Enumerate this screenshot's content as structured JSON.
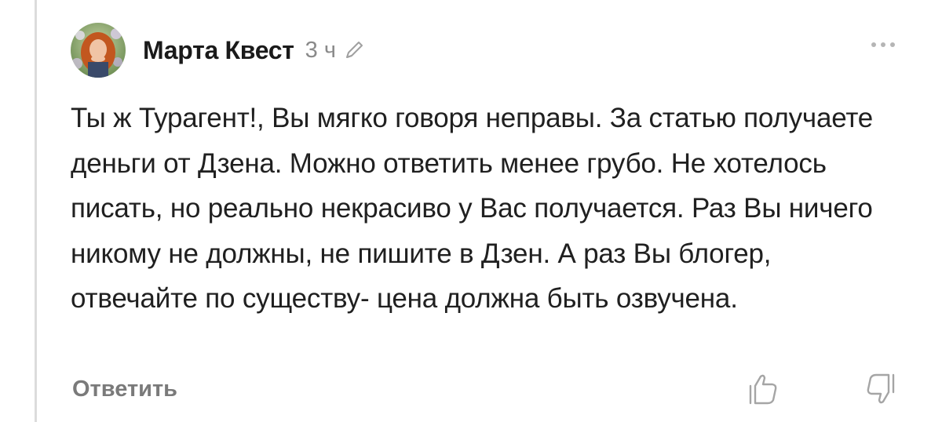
{
  "comment": {
    "author": "Марта Квест",
    "time": "3 ч",
    "text": "Ты ж Турагент!, Вы мягко говоря неправы. За статью получаете деньги от Дзена. Можно ответить менее грубо. Не хотелось писать, но реально некрасиво у Вас получается. Раз Вы ничего никому не должны, не пишите в Дзен. А раз Вы блогер, отвечайте по существу- цена должна быть озвучена.",
    "reply_label": "Ответить"
  },
  "icons": {
    "avatar": "avatar-photo",
    "edit": "pencil-icon",
    "more": "more-dots-icon",
    "like": "thumb-up-icon",
    "dislike": "thumb-down-icon"
  },
  "colors": {
    "text": "#202020",
    "secondary": "#8a8a8a",
    "thread_line": "#dcdcdc"
  }
}
